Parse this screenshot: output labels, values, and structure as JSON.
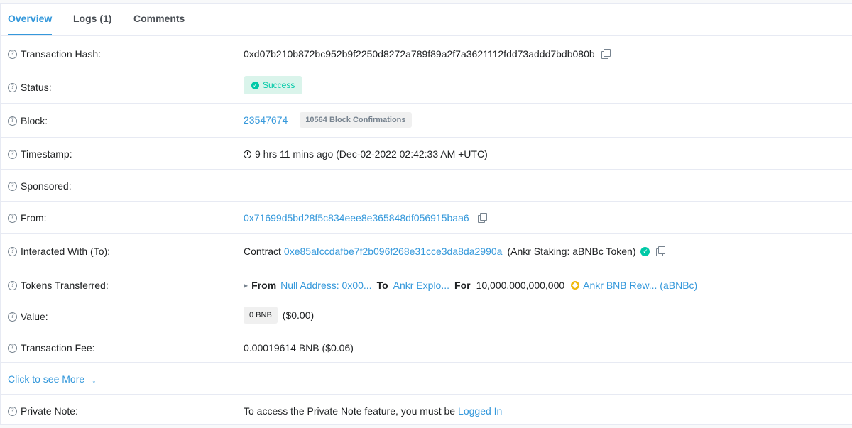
{
  "tabs": [
    {
      "label": "Overview"
    },
    {
      "label": "Logs (1)"
    },
    {
      "label": "Comments"
    }
  ],
  "rows": {
    "tx_hash": {
      "label": "Transaction Hash:",
      "value": "0xd07b210b872bc952b9f2250d8272a789f89a2f7a3621112fdd73addd7bdb080b"
    },
    "status": {
      "label": "Status:",
      "value": "Success"
    },
    "block": {
      "label": "Block:",
      "number": "23547674",
      "confirmations": "10564 Block Confirmations"
    },
    "timestamp": {
      "label": "Timestamp:",
      "value": "9 hrs 11 mins ago (Dec-02-2022 02:42:33 AM +UTC)"
    },
    "sponsored": {
      "label": "Sponsored:"
    },
    "from": {
      "label": "From:",
      "value": "0x71699d5bd28f5c834eee8e365848df056915baa6"
    },
    "interacted": {
      "label": "Interacted With (To):",
      "prefix": "Contract",
      "address": "0xe85afccdafbe7f2b096f268e31cce3da8da2990a",
      "name": "(Ankr Staking: aBNBc Token)"
    },
    "tokens": {
      "label": "Tokens Transferred:",
      "from_label": "From",
      "from_value": "Null Address: 0x00...",
      "to_label": "To",
      "to_value": "Ankr Explo...",
      "for_label": "For",
      "amount": "10,000,000,000,000",
      "token": "Ankr BNB Rew... (aBNBc)"
    },
    "value": {
      "label": "Value:",
      "amount": "0 BNB",
      "usd": "($0.00)"
    },
    "fee": {
      "label": "Transaction Fee:",
      "value": "0.00019614 BNB ($0.06)"
    },
    "more": {
      "label": "Click to see More"
    },
    "note": {
      "label": "Private Note:",
      "text": "To access the Private Note feature, you must be",
      "link": "Logged In"
    }
  },
  "icons": {
    "help": "question-circle-icon",
    "copy": "copy-icon",
    "check": "check-circle-icon",
    "clock": "clock-icon",
    "verified": "verified-check-icon",
    "token": "bnb-token-icon",
    "arrow": "arrow-down-icon"
  },
  "colors": {
    "accent": "#3498db",
    "success": "#00c9a7",
    "success_bg": "#daf4eb",
    "token": "#f0b90b"
  }
}
